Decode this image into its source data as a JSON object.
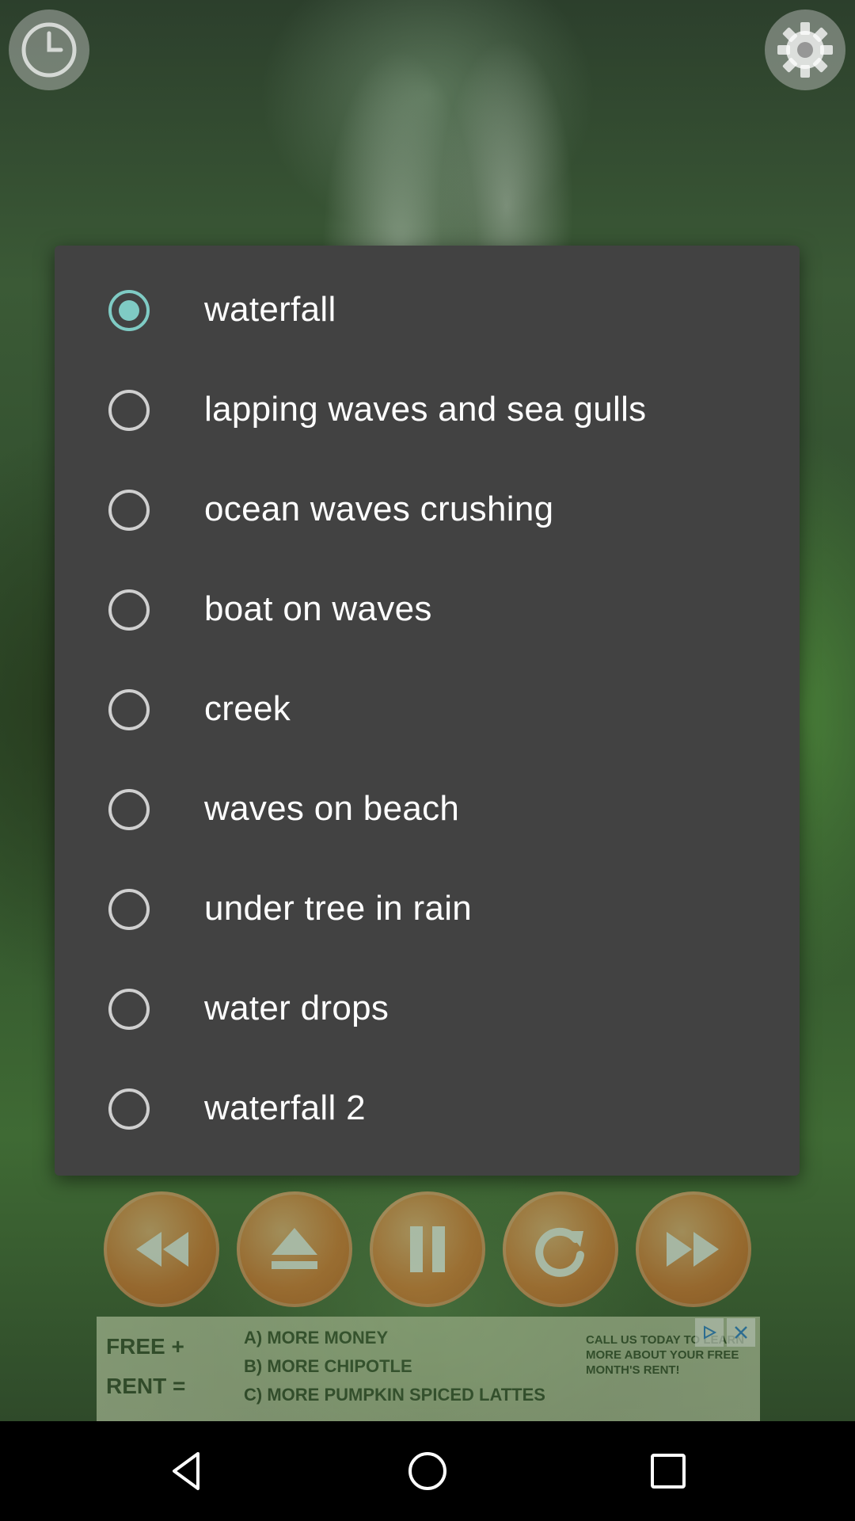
{
  "header": {
    "left_icon": "clock-icon",
    "right_icon": "gear-icon"
  },
  "dialog": {
    "selected_index": 0,
    "options": [
      {
        "label": "waterfall",
        "checked": true
      },
      {
        "label": "lapping waves and sea gulls",
        "checked": false
      },
      {
        "label": "ocean waves crushing",
        "checked": false
      },
      {
        "label": "boat on waves",
        "checked": false
      },
      {
        "label": "creek",
        "checked": false
      },
      {
        "label": "waves on beach",
        "checked": false
      },
      {
        "label": "under tree in rain",
        "checked": false
      },
      {
        "label": "water drops",
        "checked": false
      },
      {
        "label": "waterfall 2",
        "checked": false
      }
    ],
    "accent_color": "#7fcbc4"
  },
  "controls": {
    "buttons": [
      "rewind-icon",
      "eject-icon",
      "pause-icon",
      "repeat-icon",
      "fast-forward-icon"
    ]
  },
  "ad": {
    "free": "FREE +",
    "rent": "RENT =",
    "lines": [
      "A) MORE MONEY",
      "B) MORE CHIPOTLE",
      "C) MORE PUMPKIN SPICED LATTES"
    ],
    "right_text": "CALL US TODAY TO LEARN MORE ABOUT YOUR FREE MONTH'S RENT!"
  },
  "navbar": {
    "buttons": [
      "back-icon",
      "home-icon",
      "recents-icon"
    ]
  }
}
